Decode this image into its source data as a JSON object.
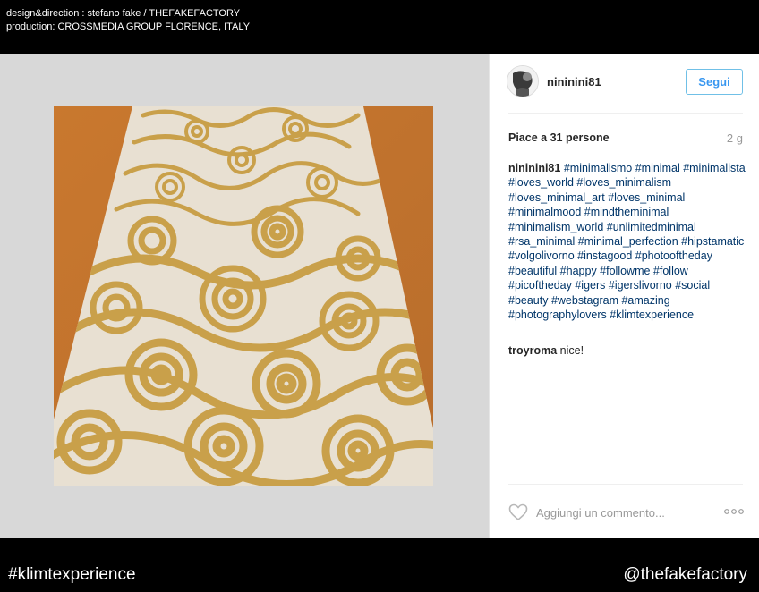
{
  "credits": {
    "line1": "design&direction : stefano fake / THEFAKEFACTORY",
    "line2": "production: CROSSMEDIA GROUP FLORENCE, ITALY"
  },
  "post": {
    "username": "nininini81",
    "follow_label": "Segui",
    "likes": "Piace a 31 persone",
    "age": "2 g",
    "caption_user": "nininini81",
    "caption_tags": "#minimalismo #minimal #minimalista #loves_world #loves_minimalism #loves_minimal_art #loves_minimal #minimalmood #mindtheminimal #minimalism_world #unlimitedminimal #rsa_minimal #minimal_perfection #hipstamatic #volgolivorno #instagood #photooftheday #beautiful #happy #followme #follow #picoftheday #igers #igerslivorno #social #beauty #webstagram #amazing #photographylovers #klimtexperience",
    "comments": [
      {
        "user": "troyroma",
        "text": "nice!"
      }
    ],
    "comment_placeholder": "Aggiungi un commento..."
  },
  "footer": {
    "hashtag": "#klimtexperience",
    "handle": "@thefakefactory"
  },
  "icons": {
    "like": "heart-outline-icon",
    "more": "ellipsis-icon"
  },
  "colors": {
    "follow_border": "#70c0e7",
    "follow_text": "#3897f0",
    "hashtag": "#003569",
    "background": "#000000"
  }
}
